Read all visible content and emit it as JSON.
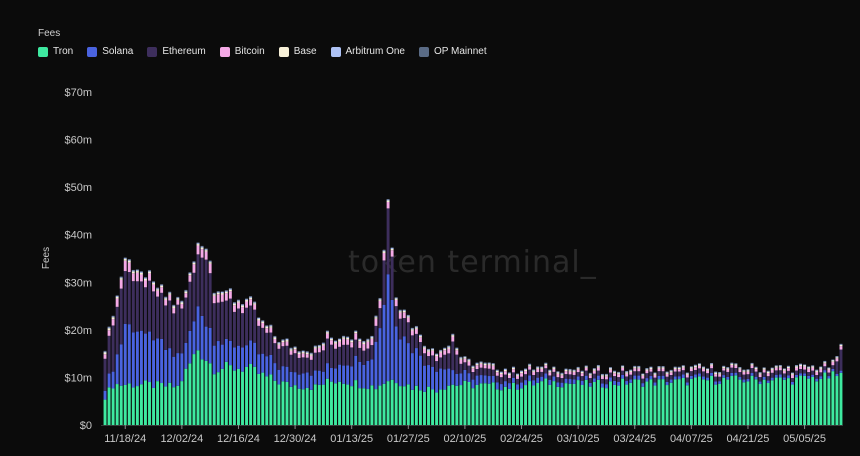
{
  "chart_data": {
    "type": "bar",
    "stacked": true,
    "legend_title": "Fees",
    "ylabel": "Fees",
    "watermark": "token terminal_",
    "ylim": [
      0,
      70
    ],
    "y_ticks": [
      0,
      10,
      20,
      30,
      40,
      50,
      60,
      70
    ],
    "y_tick_labels": [
      "$0",
      "$10m",
      "$20m",
      "$30m",
      "$40m",
      "$50m",
      "$60m",
      "$70m"
    ],
    "x_tick_labels": [
      "11/18/24",
      "12/02/24",
      "12/16/24",
      "12/30/24",
      "01/13/25",
      "01/27/25",
      "02/10/25",
      "02/24/25",
      "03/10/25",
      "03/24/25",
      "04/07/25",
      "04/21/25",
      "05/05/25"
    ],
    "x_tick_positions": [
      5,
      19,
      33,
      47,
      61,
      75,
      89,
      103,
      117,
      131,
      145,
      159,
      173
    ],
    "num_days": 183,
    "legend_position": "top-left",
    "grid": false,
    "colors": {
      "Tron": "#3ee9a0",
      "Solana": "#4a63e0",
      "Ethereum": "#3d2e5c",
      "Bitcoin": "#f4a9e6",
      "Base": "#f7f0d8",
      "Arbitrum One": "#aec2f5",
      "OP Mainnet": "#5a6b85"
    },
    "series": [
      {
        "name": "Tron",
        "anchors": [
          [
            0,
            6
          ],
          [
            2,
            8.5
          ],
          [
            5,
            8.5
          ],
          [
            10,
            8.5
          ],
          [
            18,
            8
          ],
          [
            23,
            16
          ],
          [
            27,
            12
          ],
          [
            35,
            12
          ],
          [
            40,
            10
          ],
          [
            45,
            8.5
          ],
          [
            52,
            8
          ],
          [
            55,
            9
          ],
          [
            58,
            9.5
          ],
          [
            61,
            9
          ],
          [
            67,
            8
          ],
          [
            70,
            9.5
          ],
          [
            72,
            9.5
          ],
          [
            76,
            8
          ],
          [
            82,
            7.5
          ],
          [
            85,
            8.5
          ],
          [
            89,
            8.5
          ],
          [
            100,
            8
          ],
          [
            110,
            9
          ],
          [
            120,
            8.5
          ],
          [
            130,
            9
          ],
          [
            140,
            9
          ],
          [
            150,
            9.5
          ],
          [
            160,
            9.5
          ],
          [
            170,
            9.5
          ],
          [
            178,
            10
          ],
          [
            182,
            10.5
          ]
        ]
      },
      {
        "name": "Solana",
        "anchors": [
          [
            0,
            2
          ],
          [
            2,
            3.5
          ],
          [
            5,
            12
          ],
          [
            10,
            11
          ],
          [
            15,
            8
          ],
          [
            20,
            5
          ],
          [
            23,
            9
          ],
          [
            26,
            7
          ],
          [
            30,
            5
          ],
          [
            35,
            5
          ],
          [
            40,
            4
          ],
          [
            45,
            3
          ],
          [
            52,
            3
          ],
          [
            56,
            3
          ],
          [
            60,
            4
          ],
          [
            66,
            6
          ],
          [
            68,
            12
          ],
          [
            70,
            22
          ],
          [
            72,
            12
          ],
          [
            75,
            9
          ],
          [
            80,
            5
          ],
          [
            84,
            4
          ],
          [
            86,
            3
          ],
          [
            90,
            2
          ],
          [
            95,
            1.5
          ],
          [
            100,
            1.2
          ],
          [
            110,
            1
          ],
          [
            120,
            0.8
          ],
          [
            130,
            0.8
          ],
          [
            150,
            0.6
          ],
          [
            182,
            0.5
          ]
        ]
      },
      {
        "name": "Ethereum",
        "anchors": [
          [
            0,
            7.5
          ],
          [
            2,
            10
          ],
          [
            5,
            11
          ],
          [
            10,
            10
          ],
          [
            15,
            9
          ],
          [
            20,
            9.5
          ],
          [
            23,
            12
          ],
          [
            25,
            13
          ],
          [
            28,
            8
          ],
          [
            30,
            9
          ],
          [
            33,
            8
          ],
          [
            35,
            7.5
          ],
          [
            40,
            5
          ],
          [
            45,
            4
          ],
          [
            50,
            3
          ],
          [
            55,
            5
          ],
          [
            57,
            4
          ],
          [
            60,
            4
          ],
          [
            65,
            2.5
          ],
          [
            68,
            4
          ],
          [
            70,
            13.5
          ],
          [
            72,
            4
          ],
          [
            75,
            4
          ],
          [
            80,
            2
          ],
          [
            85,
            3
          ],
          [
            86,
            6
          ],
          [
            88,
            1.8
          ],
          [
            90,
            1.5
          ],
          [
            95,
            1.5
          ],
          [
            100,
            1.2
          ],
          [
            110,
            1
          ],
          [
            120,
            1
          ],
          [
            140,
            1
          ],
          [
            160,
            1
          ],
          [
            175,
            0.8
          ],
          [
            180,
            0.8
          ],
          [
            182,
            4
          ]
        ]
      },
      {
        "name": "Bitcoin",
        "anchors": [
          [
            0,
            1
          ],
          [
            5,
            2
          ],
          [
            10,
            1.5
          ],
          [
            20,
            1
          ],
          [
            23,
            2
          ],
          [
            30,
            1.5
          ],
          [
            40,
            1
          ],
          [
            50,
            0.8
          ],
          [
            55,
            1
          ],
          [
            70,
            1.5
          ],
          [
            75,
            1
          ],
          [
            85,
            1
          ],
          [
            90,
            0.8
          ],
          [
            100,
            0.7
          ],
          [
            120,
            0.6
          ],
          [
            150,
            0.5
          ],
          [
            182,
            0.7
          ]
        ]
      },
      {
        "name": "Base",
        "anchors": [
          [
            0,
            0.4
          ],
          [
            20,
            0.3
          ],
          [
            60,
            0.3
          ],
          [
            100,
            0.25
          ],
          [
            182,
            0.25
          ]
        ]
      },
      {
        "name": "Arbitrum One",
        "anchors": [
          [
            0,
            0.2
          ],
          [
            60,
            0.2
          ],
          [
            182,
            0.15
          ]
        ]
      },
      {
        "name": "OP Mainnet",
        "anchors": [
          [
            0,
            0.15
          ],
          [
            182,
            0.1
          ]
        ]
      }
    ]
  }
}
